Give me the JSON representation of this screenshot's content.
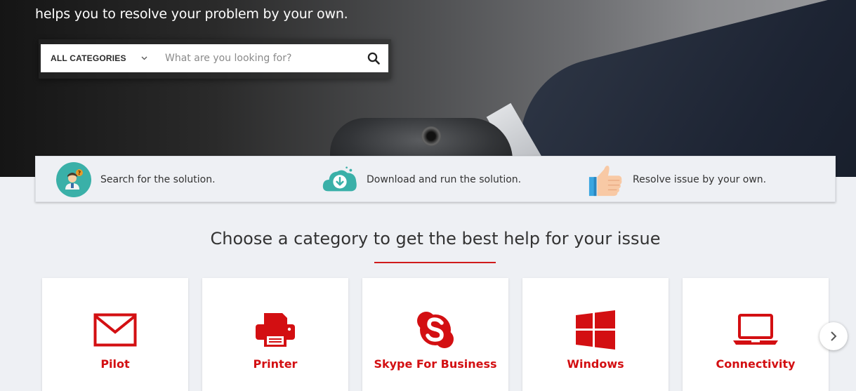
{
  "hero": {
    "tagline": "helps you to resolve your problem by your own."
  },
  "search": {
    "category_label": "ALL CATEGORIES",
    "placeholder": "What are you looking for?",
    "icons": {
      "dropdown": "chevron-down-icon",
      "submit": "search-icon"
    }
  },
  "steps": [
    {
      "text": "Search for the solution.",
      "icon": "support-person-icon"
    },
    {
      "text": "Download and run the solution.",
      "icon": "cloud-download-icon"
    },
    {
      "text": "Resolve issue by your own.",
      "icon": "thumbs-up-icon"
    }
  ],
  "section": {
    "title": "Choose a category to get the best help for your issue"
  },
  "categories": [
    {
      "label": "Pilot",
      "icon": "envelope-icon"
    },
    {
      "label": "Printer",
      "icon": "printer-icon"
    },
    {
      "label": "Skype For Business",
      "icon": "skype-icon"
    },
    {
      "label": "Windows",
      "icon": "windows-icon"
    },
    {
      "label": "Connectivity",
      "icon": "laptop-icon"
    }
  ],
  "carousel": {
    "next_icon": "chevron-right-icon"
  },
  "colors": {
    "accent": "#d30f12",
    "page_bg": "#eef0f4",
    "card_bg": "#ffffff",
    "step_teal": "#3ab0a8"
  }
}
